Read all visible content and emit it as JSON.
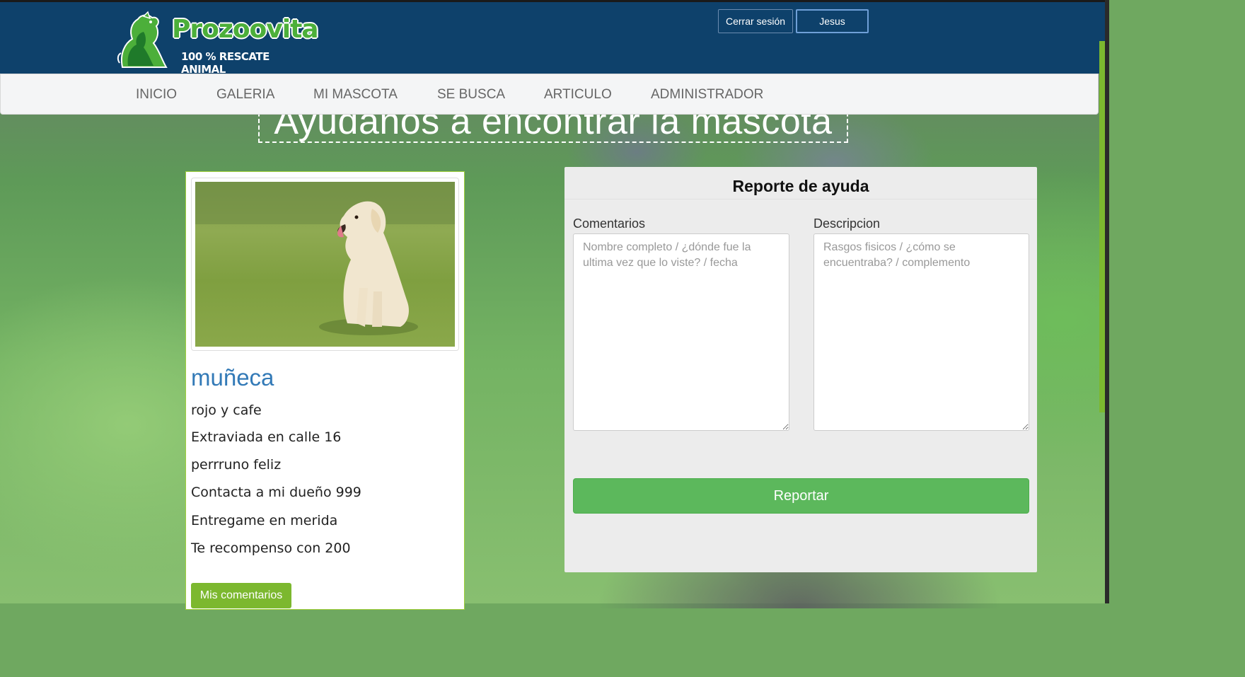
{
  "header": {
    "logo_name": "Prozoovita",
    "logo_tagline": "100 % RESCATE ANIMAL",
    "logout_label": "Cerrar sesión",
    "user_label": "Jesus"
  },
  "nav": {
    "items": [
      {
        "label": "INICIO"
      },
      {
        "label": "GALERIA"
      },
      {
        "label": "MI MASCOTA"
      },
      {
        "label": "SE BUSCA"
      },
      {
        "label": "ARTICULO"
      },
      {
        "label": "ADMINISTRADOR"
      }
    ]
  },
  "page": {
    "title": "Ayudanos a encontrar la mascota"
  },
  "pet": {
    "name": "muñeca",
    "lines": [
      "rojo y cafe",
      "Extraviada en calle 16",
      "perrruno feliz",
      "Contacta a mi dueño 999",
      "Entregame en merida",
      "Te recompenso con 200"
    ],
    "comments_button": "Mis comentarios"
  },
  "report": {
    "title": "Reporte de ayuda",
    "comments_label": "Comentarios",
    "comments_placeholder": "Nombre completo / ¿dónde fue la ultima vez que lo viste? / fecha",
    "description_label": "Descripcion",
    "description_placeholder": "Rasgos fisicos / ¿cómo se encuentraba? / complemento",
    "submit_label": "Reportar"
  },
  "colors": {
    "header_bg": "#0e416b",
    "accent_green": "#7cb82f",
    "report_button": "#5cb85c",
    "pet_name": "#337ab7"
  }
}
